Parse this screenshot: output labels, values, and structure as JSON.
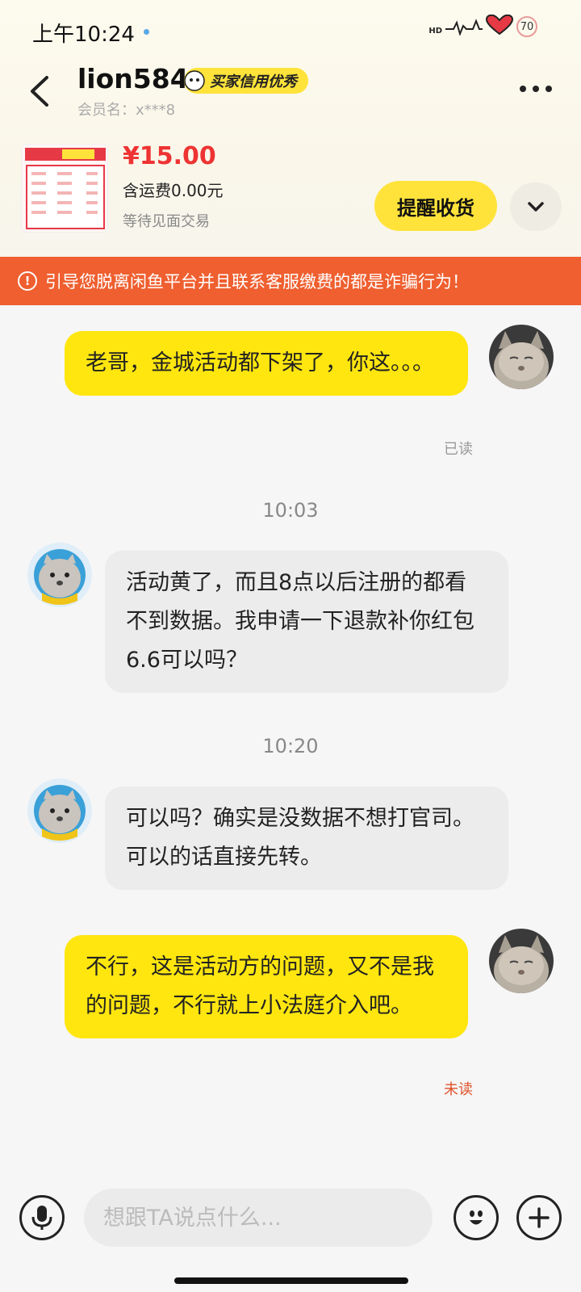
{
  "status_bar": {
    "time": "上午10:24",
    "battery": "70",
    "signal_label": "HD"
  },
  "header": {
    "username": "lion584",
    "credit_badge": "买家信用优秀",
    "member_line": "会员名：x***8"
  },
  "product": {
    "price": "¥15.00",
    "shipping": "含运费0.00元",
    "status": "等待见面交易",
    "remind_button": "提醒收货"
  },
  "warning": {
    "text": "引导您脱离闲鱼平台并且联系客服缴费的都是诈骗行为！"
  },
  "messages": [
    {
      "side": "me",
      "text": "老哥，金城活动都下架了，你这。。。",
      "read_status": "已读"
    },
    {
      "type": "time",
      "text": "10:03"
    },
    {
      "side": "other",
      "text": "活动黄了，而且8点以后注册的都看不到数据。我申请一下退款补你红包6.6可以吗？"
    },
    {
      "type": "time",
      "text": "10:20"
    },
    {
      "side": "other",
      "text": "可以吗？确实是没数据不想打官司。可以的话直接先转。"
    },
    {
      "side": "me",
      "text": "不行，这是活动方的问题，又不是我的问题，不行就上小法庭介入吧。",
      "read_status": "未读"
    }
  ],
  "input": {
    "placeholder": "想跟TA说点什么..."
  },
  "colors": {
    "accent_yellow": "#ffe60f",
    "warning_orange": "#ef5f2f",
    "price_red": "#ee3333",
    "unread_red": "#e0522b",
    "read_gray": "#999999"
  }
}
